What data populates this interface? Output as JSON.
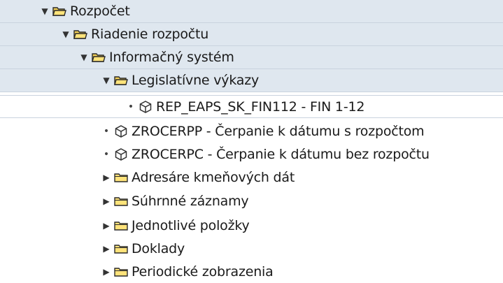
{
  "tree": {
    "nodes": [
      {
        "label": "Rozpočet",
        "type": "folder",
        "state": "expanded"
      },
      {
        "label": "Riadenie rozpočtu",
        "type": "folder",
        "state": "expanded"
      },
      {
        "label": "Informačný systém",
        "type": "folder",
        "state": "expanded"
      },
      {
        "label": "Legislatívne výkazy",
        "type": "folder",
        "state": "expanded"
      },
      {
        "label": "REP_EAPS_SK_FIN112 - FIN 1-12",
        "type": "transaction",
        "selected": true
      },
      {
        "label": "ZROCERPP - Čerpanie k dátumu s rozpočtom",
        "type": "transaction"
      },
      {
        "label": "ZROCERPC - Čerpanie k dátumu bez rozpočtu",
        "type": "transaction"
      },
      {
        "label": "Adresáre kmeňových dát",
        "type": "folder",
        "state": "collapsed"
      },
      {
        "label": "Súhrnné záznamy",
        "type": "folder",
        "state": "collapsed"
      },
      {
        "label": "Jednotlivé položky",
        "type": "folder",
        "state": "collapsed"
      },
      {
        "label": "Doklady",
        "type": "folder",
        "state": "collapsed"
      },
      {
        "label": "Periodické zobrazenia",
        "type": "folder",
        "state": "collapsed"
      }
    ]
  },
  "icons": {
    "expanded_toggle": "triangle-down-icon",
    "collapsed_toggle": "triangle-right-icon",
    "open_folder": "folder-open-icon",
    "closed_folder": "folder-closed-icon",
    "transaction": "cube-icon",
    "leaf_bullet": "bullet-icon"
  },
  "colors": {
    "shaded_row": "#dfe7ef",
    "folder_fill": "#ffe37a",
    "folder_stroke": "#2a2a2a",
    "cube_stroke": "#333333"
  }
}
